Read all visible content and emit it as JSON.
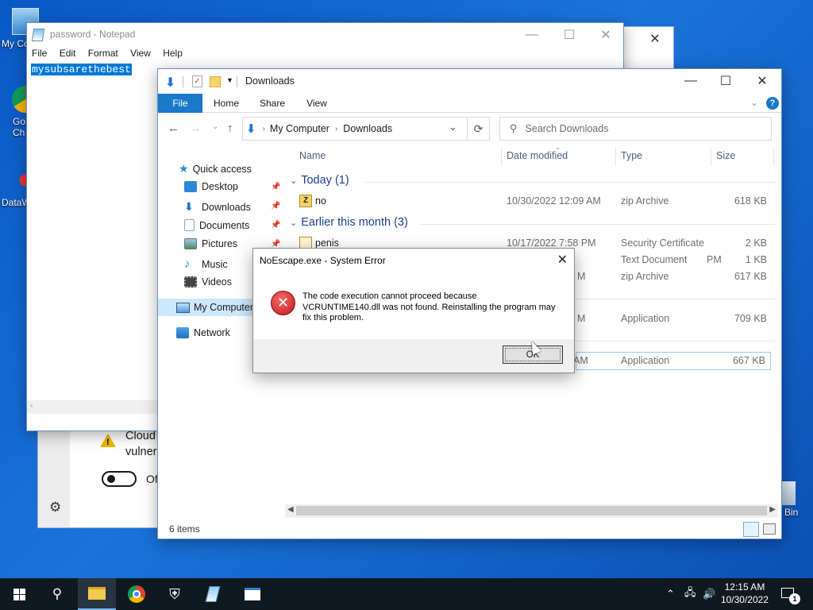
{
  "desktop": {
    "icons": [
      {
        "label": "My Co",
        "icon": "computer-icon"
      },
      {
        "label": "Go\nCh",
        "icon": "chrome-icon"
      },
      {
        "label": "DataW",
        "icon": "datawiper-icon"
      },
      {
        "label": "e Bin",
        "icon": "recycle-bin-icon"
      }
    ]
  },
  "settings_window": {
    "warning_text_1": "Cloud",
    "warning_text_2": "vulner",
    "toggle_label": "Of"
  },
  "notepad": {
    "title": "password - Notepad",
    "menu": [
      "File",
      "Edit",
      "Format",
      "View",
      "Help"
    ],
    "content": "mysubsarethebest"
  },
  "explorer": {
    "title": "Downloads",
    "ribbon_tabs": [
      "File",
      "Home",
      "Share",
      "View"
    ],
    "address": [
      "My Computer",
      "Downloads"
    ],
    "search_placeholder": "Search Downloads",
    "nav": {
      "quick_access": "Quick access",
      "items": [
        "Desktop",
        "Downloads",
        "Documents",
        "Pictures",
        "Music",
        "Videos"
      ],
      "my_computer": "My Computer",
      "network": "Network"
    },
    "columns": [
      "Name",
      "Date modified",
      "Type",
      "Size"
    ],
    "groups": [
      {
        "label": "Today (1)"
      },
      {
        "label": "Earlier this month (3)"
      }
    ],
    "rows": [
      {
        "name": "no",
        "date": "10/30/2022 12:09 AM",
        "type": "zip Archive",
        "size": "618 KB"
      },
      {
        "name": "penis",
        "date": "10/17/2022 7:58 PM",
        "type": "Security Certificate",
        "size": "2 KB"
      },
      {
        "name": "",
        "date": "PM",
        "type": "Text Document",
        "size": "1 KB"
      },
      {
        "name": "",
        "date": "M",
        "type": "zip Archive",
        "size": "617 KB"
      },
      {
        "name": "",
        "date": "M",
        "type": "Application",
        "size": "709 KB"
      },
      {
        "name": "",
        "date": "AM",
        "type": "Application",
        "size": "667 KB"
      }
    ],
    "status": "6 items"
  },
  "dialog": {
    "title": "NoEscape.exe - System Error",
    "message": "The code execution cannot proceed because VCRUNTIME140.dll was not found. Reinstalling the program may fix this problem.",
    "ok_label": "OK"
  },
  "taskbar": {
    "time": "12:15 AM",
    "date": "10/30/2022",
    "notification_count": "1"
  },
  "colors": {
    "accent": "#1979ca",
    "error_red": "#d32f2f",
    "desktop_blue": "#0a58c4",
    "taskbar": "#101820"
  }
}
